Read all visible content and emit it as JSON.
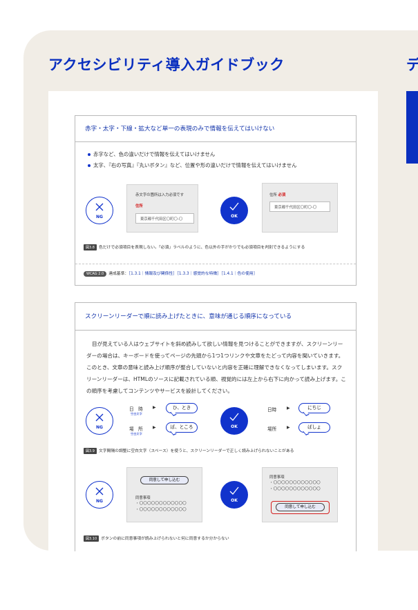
{
  "page": {
    "title": "アクセシビリティ導入ガイドブック",
    "next_title_start": "デ"
  },
  "section1": {
    "heading": "赤字・太字・下線・拡大など単一の表現のみで情報を伝えてはいけない",
    "bullets": [
      "赤字など、色の違いだけで情報を伝えてはいけません",
      "太字、『右の写真』『丸いボタン』など、位置や形の違いだけで情報を伝えてはいけません"
    ],
    "ng_label": "NG",
    "ok_label": "OK",
    "ng_demo": {
      "note": "赤文字の箇所は入力必須です",
      "field_label": "住所",
      "input_value": "東京都千代田区〇町〇-〇"
    },
    "ok_demo": {
      "field_label": "住所",
      "required": "必須",
      "input_value": "東京都千代田区〇町〇-〇"
    },
    "fig_tag": "図3.8",
    "fig_caption": "色だけで必須項目を表現しない。「必須」ラベルのように、色以外の手がかりでも必須項目を判別できるようにする",
    "wcag_tag": "WCAG 2.0",
    "wcag_prefix": "達成基準：",
    "wcag_links": [
      "［1.3.1｜情報及び関係性］",
      "［1.3.3｜感覚的な特徴］",
      "［1.4.1｜色の使用］"
    ]
  },
  "section2": {
    "heading": "スクリーンリーダーで順に読み上げたときに、意味が通じる順序になっている",
    "paragraph": "目が見えている人はウェブサイトを斜め読みして欲しい情報を見つけることができますが、スクリーンリーダーの場合は、キーボードを使ってページの先頭から1つ1つリンクや文章をたどって内容を聞いていきます。このとき、文章の意味と読み上げ順序が整合していないと内容を正確に理解できなくなってしまいます。スクリーンリーダーは、HTMLのソースに記載されている順、視覚的には左上から右下に向かって読み上げます。この順序を考慮してコンテンツやサービスを設計してください。",
    "ng_label": "NG",
    "ok_label": "OK",
    "ng_rows": [
      {
        "label": "日　時",
        "sub": "空白文字",
        "spoken": "ひ、とき"
      },
      {
        "label": "場　所",
        "sub": "空白文字",
        "spoken": "ば、ところ"
      }
    ],
    "ok_rows": [
      {
        "label": "日時",
        "spoken": "にちじ"
      },
      {
        "label": "場所",
        "spoken": "ばしょ"
      }
    ],
    "fig1_tag": "図3.9",
    "fig1_caption": "文字間隔の調整に空白文字（スペース）を使うと、スクリーンリーダーで正しく読み上げられないことがある",
    "button_label": "同意して申し込む",
    "agree_title": "同意事項",
    "agree_lines": [
      "・〇〇〇〇〇〇〇〇〇〇〇〇",
      "・〇〇〇〇〇〇〇〇〇〇〇〇"
    ],
    "fig2_tag": "図3.10",
    "fig2_caption": "ボタンの前に同意事項が読み上げられないと何に同意するか分からない"
  },
  "colors": {
    "accent": "#0a2fbf",
    "link": "#1133aa",
    "required_red": "#d21c1c",
    "panel_bg": "#f1ede6"
  }
}
